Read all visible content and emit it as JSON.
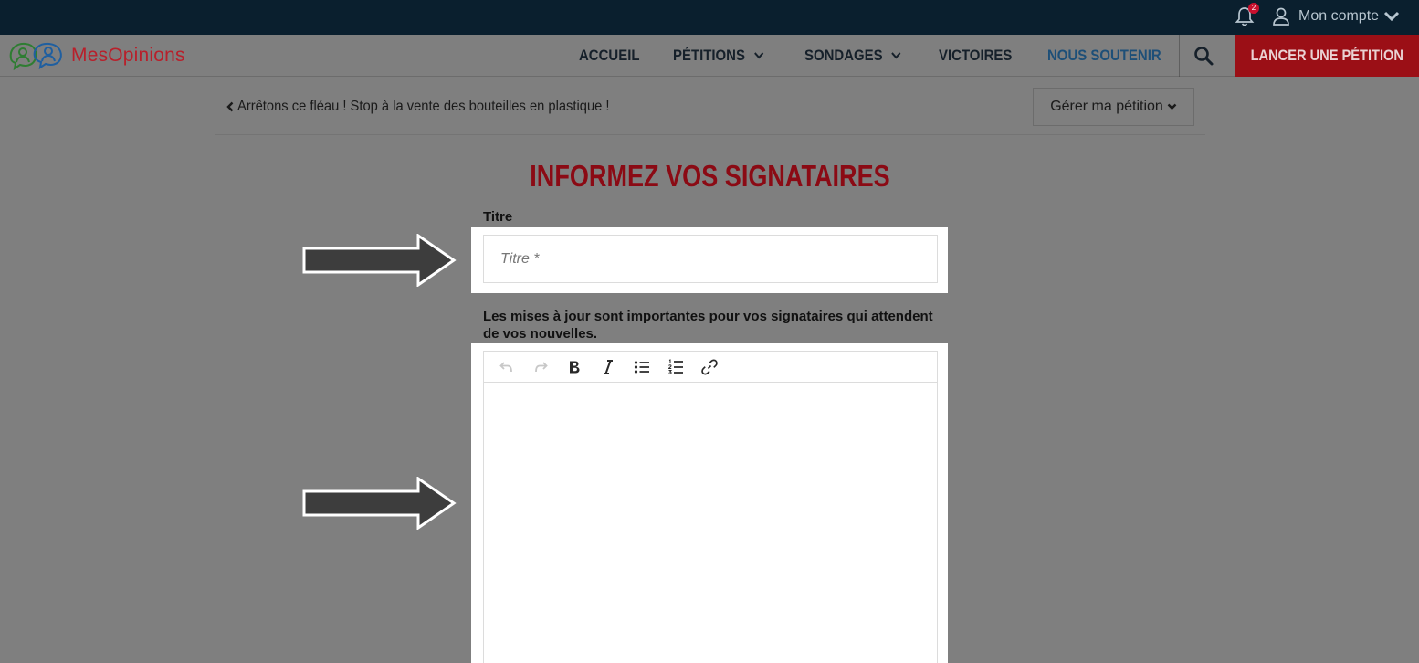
{
  "header": {
    "notification_count": "2",
    "account_label": "Mon compte"
  },
  "nav": {
    "logo_text": "MesOpinions",
    "items": [
      {
        "label": "ACCUEIL"
      },
      {
        "label": "PÉTITIONS"
      },
      {
        "label": "SONDAGES"
      },
      {
        "label": "VICTOIRES"
      },
      {
        "label": "NOUS SOUTENIR"
      }
    ],
    "cta_label": "LANCER UNE PÉTITION"
  },
  "subheader": {
    "back_label": "Arrêtons ce fléau ! Stop à la vente des bouteilles en plastique !",
    "manage_label": "Gérer ma pétition"
  },
  "form": {
    "heading": "INFORMEZ VOS SIGNATAIRES",
    "title_label": "Titre",
    "title_placeholder": "Titre *",
    "title_value": "",
    "body_label": "Les mises à jour sont importantes pour vos signataires qui attendent de vos nouvelles.",
    "body_value": ""
  },
  "colors": {
    "brand_red": "#9b0f16",
    "heading_red": "#8b0a14",
    "support_blue": "#1d4f78",
    "topbar": "#0a1f2e"
  },
  "icons": [
    "bell-icon",
    "user-icon",
    "chevron-down-icon",
    "search-icon",
    "undo-icon",
    "redo-icon",
    "bold-icon",
    "italic-icon",
    "bullet-list-icon",
    "numbered-list-icon",
    "link-icon",
    "arrow-pointer-icon"
  ]
}
